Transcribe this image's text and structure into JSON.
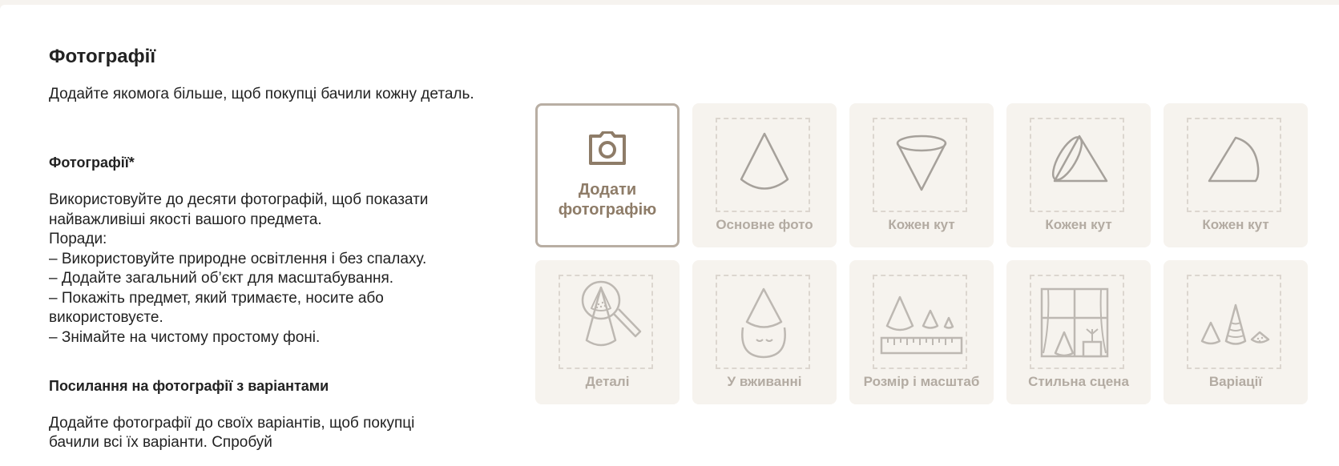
{
  "section_title": "Фотографії",
  "intro": "Додайте якомога більше, щоб покупці бачили кожну деталь.",
  "photos_heading": "Фотографії*",
  "tips": [
    "Використовуйте до десяти фотографій, щоб показати",
    "найважливіші якості вашого предмета.",
    "Поради:",
    "– Використовуйте природне освітлення і без спалаху.",
    "– Додайте загальний об’єкт для масштабування.",
    "– Покажіть предмет, який тримаєте, носите або",
    "використовуєте.",
    "– Знімайте на чистому простому фоні."
  ],
  "variants_heading": "Посилання на фотографії з варіантами",
  "variants_text": "Додайте фотографії до своїх варіантів, щоб покупці бачили всі їх варіанти. Спробуй",
  "add_photo": {
    "line1": "Додати",
    "line2": "фотографію",
    "icon": "camera-icon"
  },
  "slots": [
    {
      "label": "Основне фото",
      "icon": "cone-icon"
    },
    {
      "label": "Кожен кут",
      "icon": "cone-inverted-icon"
    },
    {
      "label": "Кожен кут",
      "icon": "cone-tilted-icon"
    },
    {
      "label": "Кожен кут",
      "icon": "cone-side-icon"
    },
    {
      "label": "Деталі",
      "icon": "magnifier-cone-icon"
    },
    {
      "label": "У вживанні",
      "icon": "cone-hat-person-icon"
    },
    {
      "label": "Розмір і масштаб",
      "icon": "cones-ruler-icon"
    },
    {
      "label": "Стильна сцена",
      "icon": "window-scene-icon"
    },
    {
      "label": "Варіації",
      "icon": "cone-variations-icon"
    }
  ],
  "colors": {
    "accent_text": "#8e7c68",
    "tile_bg": "#f6f3ee",
    "border": "#b8aea3",
    "muted": "#b3aba2"
  }
}
